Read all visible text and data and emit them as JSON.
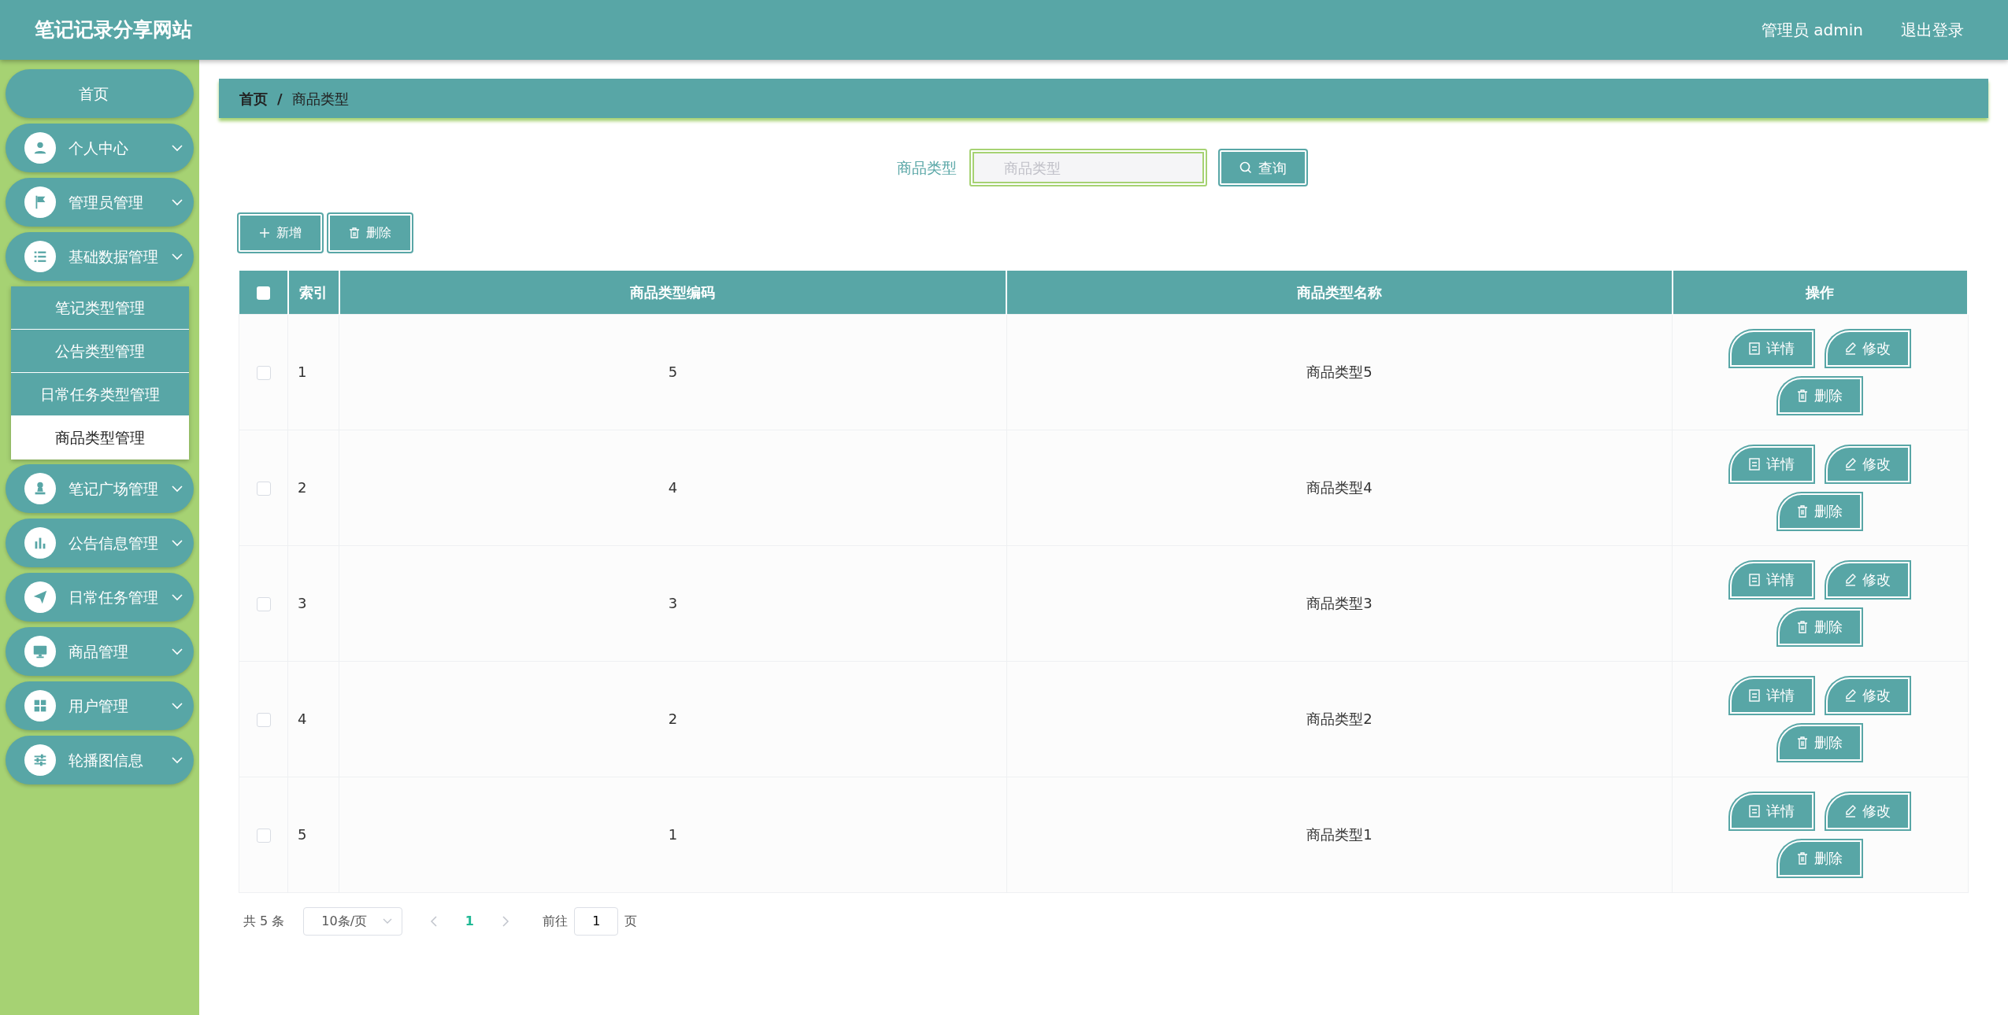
{
  "header": {
    "title": "笔记记录分享网站",
    "user": "管理员 admin",
    "logout": "退出登录"
  },
  "sidebar": {
    "items": [
      {
        "kind": "link",
        "label": "首页"
      },
      {
        "kind": "menu",
        "label": "个人中心"
      },
      {
        "kind": "menu",
        "label": "管理员管理"
      },
      {
        "kind": "menu",
        "label": "基础数据管理",
        "expanded": true,
        "children": [
          {
            "label": "笔记类型管理",
            "selected": false
          },
          {
            "label": "公告类型管理",
            "selected": false
          },
          {
            "label": "日常任务类型管理",
            "selected": false
          },
          {
            "label": "商品类型管理",
            "selected": true
          }
        ]
      },
      {
        "kind": "menu",
        "label": "笔记广场管理"
      },
      {
        "kind": "menu",
        "label": "公告信息管理"
      },
      {
        "kind": "menu",
        "label": "日常任务管理"
      },
      {
        "kind": "menu",
        "label": "商品管理"
      },
      {
        "kind": "menu",
        "label": "用户管理"
      },
      {
        "kind": "menu",
        "label": "轮播图信息"
      }
    ]
  },
  "breadcrumb": {
    "items": [
      "首页",
      "商品类型"
    ],
    "separator": "/"
  },
  "search": {
    "label": "商品类型",
    "placeholder": "商品类型",
    "button": "查询"
  },
  "toolbar": [
    {
      "kind": "add",
      "label": "新增"
    },
    {
      "kind": "delete",
      "label": "删除"
    }
  ],
  "table": {
    "select_all": {
      "checked": false
    },
    "columns": [
      "索引",
      "商品类型编码",
      "商品类型名称",
      "操作"
    ],
    "rows": [
      {
        "checked": false,
        "index": "1",
        "code": "5",
        "name": "商品类型5",
        "actions": [
          "详情",
          "修改",
          "删除"
        ]
      },
      {
        "checked": false,
        "index": "2",
        "code": "4",
        "name": "商品类型4",
        "actions": [
          "详情",
          "修改",
          "删除"
        ]
      },
      {
        "checked": false,
        "index": "3",
        "code": "3",
        "name": "商品类型3",
        "actions": [
          "详情",
          "修改",
          "删除"
        ]
      },
      {
        "checked": false,
        "index": "4",
        "code": "2",
        "name": "商品类型2",
        "actions": [
          "详情",
          "修改",
          "删除"
        ]
      },
      {
        "checked": false,
        "index": "5",
        "code": "1",
        "name": "商品类型1",
        "actions": [
          "详情",
          "修改",
          "删除"
        ]
      }
    ]
  },
  "pagination": {
    "total": "共 5 条",
    "page_size": "10条/页",
    "pages": [
      {
        "label": "1",
        "selected": true
      }
    ],
    "goto_label": "前往",
    "goto_value": "1",
    "page_unit": "页"
  }
}
